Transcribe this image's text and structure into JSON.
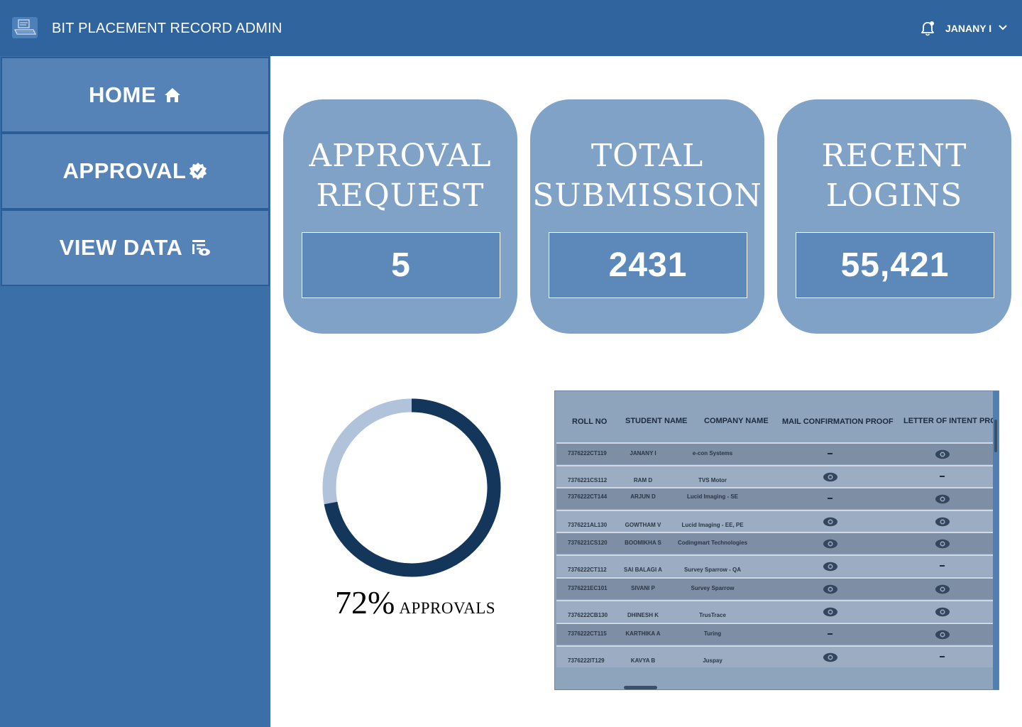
{
  "header": {
    "title": "BIT PLACEMENT RECORD ADMIN",
    "user_name": "JANANY I",
    "colors": {
      "bar": "#2f649f"
    }
  },
  "sidebar": {
    "items": [
      {
        "label": "HOME",
        "icon": "home-icon"
      },
      {
        "label": "APPROVAL",
        "icon": "verified-badge-icon"
      },
      {
        "label": "VIEW DATA",
        "icon": "view-data-icon"
      }
    ]
  },
  "cards": [
    {
      "title_line1": "APPROVAL",
      "title_line2": "REQUEST",
      "value": "5"
    },
    {
      "title_line1": "TOTAL",
      "title_line2": "SUBMISSION",
      "value": "2431"
    },
    {
      "title_line1": "RECENT",
      "title_line2": "LOGINS",
      "value": "55,421"
    }
  ],
  "approvals": {
    "percent": 72,
    "percent_label": "72%",
    "label": "APPROVALS",
    "colors": {
      "filled": "#14365b",
      "remaining": "#b0c3da"
    }
  },
  "table": {
    "headers": [
      "ROLL NO",
      "STUDENT NAME",
      "COMPANY NAME",
      "MAIL CONFIRMATION PROOF",
      "LETTER OF INTENT PRO"
    ],
    "rows": [
      {
        "roll": "7376222CT119",
        "name": "JANANY I",
        "company": "e-con Systems",
        "mail": "dash",
        "loi": "eye"
      },
      {
        "roll": "7376221CS112",
        "name": "RAM D",
        "company": "TVS Motor",
        "mail": "eye",
        "loi": "dash"
      },
      {
        "roll": "7376222CT144",
        "name": "ARJUN D",
        "company": "Lucid Imaging - SE",
        "mail": "dash",
        "loi": "eye"
      },
      {
        "roll": "7376221AL130",
        "name": "GOWTHAM V",
        "company": "Lucid Imaging - EE, PE",
        "mail": "eye",
        "loi": "eye"
      },
      {
        "roll": "7376221CS120",
        "name": "BOOMIKHA S",
        "company": "Codingmart Technologies",
        "mail": "eye",
        "loi": "eye"
      },
      {
        "roll": "7376222CT112",
        "name": "SAI BALAGI A",
        "company": "Survey Sparrow - QA",
        "mail": "eye",
        "loi": "dash"
      },
      {
        "roll": "7376221EC101",
        "name": "SIVANI P",
        "company": "Survey Sparrow",
        "mail": "eye",
        "loi": "eye"
      },
      {
        "roll": "7376222CB130",
        "name": "DHINESH K",
        "company": "TrusTrace",
        "mail": "eye",
        "loi": "eye"
      },
      {
        "roll": "7376222CT115",
        "name": "KARTHIKA A",
        "company": "Turing",
        "mail": "dash",
        "loi": "eye"
      },
      {
        "roll": "7376222IT129",
        "name": "KAVYA B",
        "company": "Juspay",
        "mail": "eye",
        "loi": "dash"
      }
    ]
  }
}
